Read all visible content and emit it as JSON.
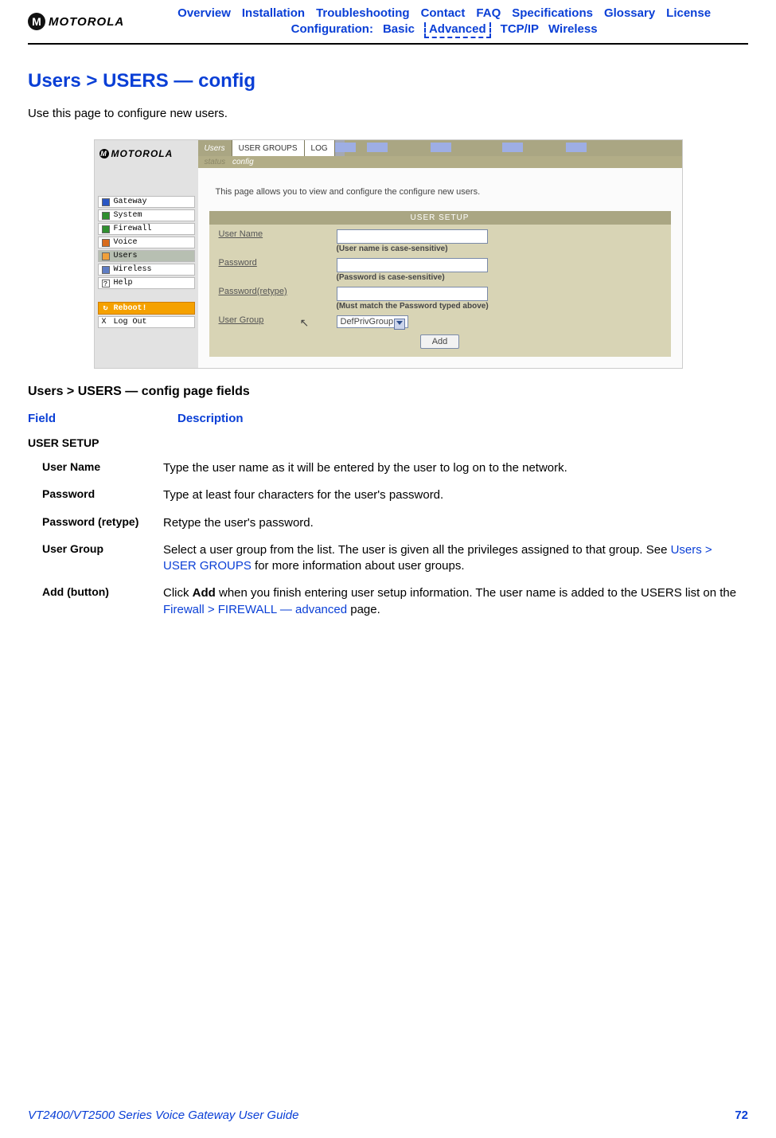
{
  "brand": "MOTOROLA",
  "nav": {
    "row1": [
      "Overview",
      "Installation",
      "Troubleshooting",
      "Contact",
      "FAQ",
      "Specifications",
      "Glossary",
      "License"
    ],
    "configuration_label": "Configuration:",
    "row2": [
      "Basic",
      "Advanced",
      "TCP/IP",
      "Wireless"
    ],
    "active": "Advanced"
  },
  "page_title": "Users > USERS — config",
  "intro": "Use this page to configure new users.",
  "screenshot": {
    "brand": "MOTOROLA",
    "side_items": [
      {
        "label": "Gateway",
        "color": "#2a57c4"
      },
      {
        "label": "System",
        "color": "#2f8f2f"
      },
      {
        "label": "Firewall",
        "color": "#2f8f2f"
      },
      {
        "label": "Voice",
        "color": "#d86b1c"
      },
      {
        "label": "Users",
        "color": "#f0a03a",
        "selected": true
      },
      {
        "label": "Wireless",
        "color": "#5e7dc4"
      },
      {
        "label": "Help",
        "color": "#bdbdbd",
        "mark": "?"
      }
    ],
    "reboot": "Reboot!",
    "logout": "Log Out",
    "tabs": [
      "Users",
      "USER GROUPS",
      "LOG"
    ],
    "active_tab": "Users",
    "subtabs": [
      "status",
      "config"
    ],
    "active_subtab": "config",
    "body_text": "This page allows you to view and configure the configure new users.",
    "panel_title": "USER SETUP",
    "form": {
      "user_name": {
        "label": "User Name",
        "hint": "(User name is case-sensitive)"
      },
      "password": {
        "label": "Password",
        "hint": "(Password is case-sensitive)"
      },
      "retype": {
        "label": "Password(retype)",
        "hint": "(Must match the Password typed above)"
      },
      "user_group": {
        "label": "User Group",
        "value": "DefPrivGroup"
      },
      "add": "Add"
    }
  },
  "fields_table": {
    "title": "Users > USERS — config page fields",
    "head": {
      "field": "Field",
      "desc": "Description"
    },
    "section": "USER SETUP",
    "rows": [
      {
        "field": "User Name",
        "desc": "Type the user name as it will be entered by the user to log on to the network."
      },
      {
        "field": "Password",
        "desc": "Type at least four characters for the user's password."
      },
      {
        "field": "Password (retype)",
        "desc": "Retype the user's password."
      },
      {
        "field": "User Group",
        "desc_parts": {
          "p1": "Select a user group from the list. The user is given all the privileges assigned to that group. See ",
          "link": "Users > USER GROUPS",
          "p2": " for more information about user groups."
        }
      },
      {
        "field": "Add (button)",
        "desc_parts": {
          "p1": "Click ",
          "bold": "Add",
          "p2": " when you finish entering user setup information. The user name is added to the USERS list on the ",
          "link": "Firewall > FIREWALL — advanced",
          "p3": " page."
        }
      }
    ]
  },
  "footer": {
    "doc": "VT2400/VT2500 Series Voice Gateway User Guide",
    "page": "72"
  }
}
